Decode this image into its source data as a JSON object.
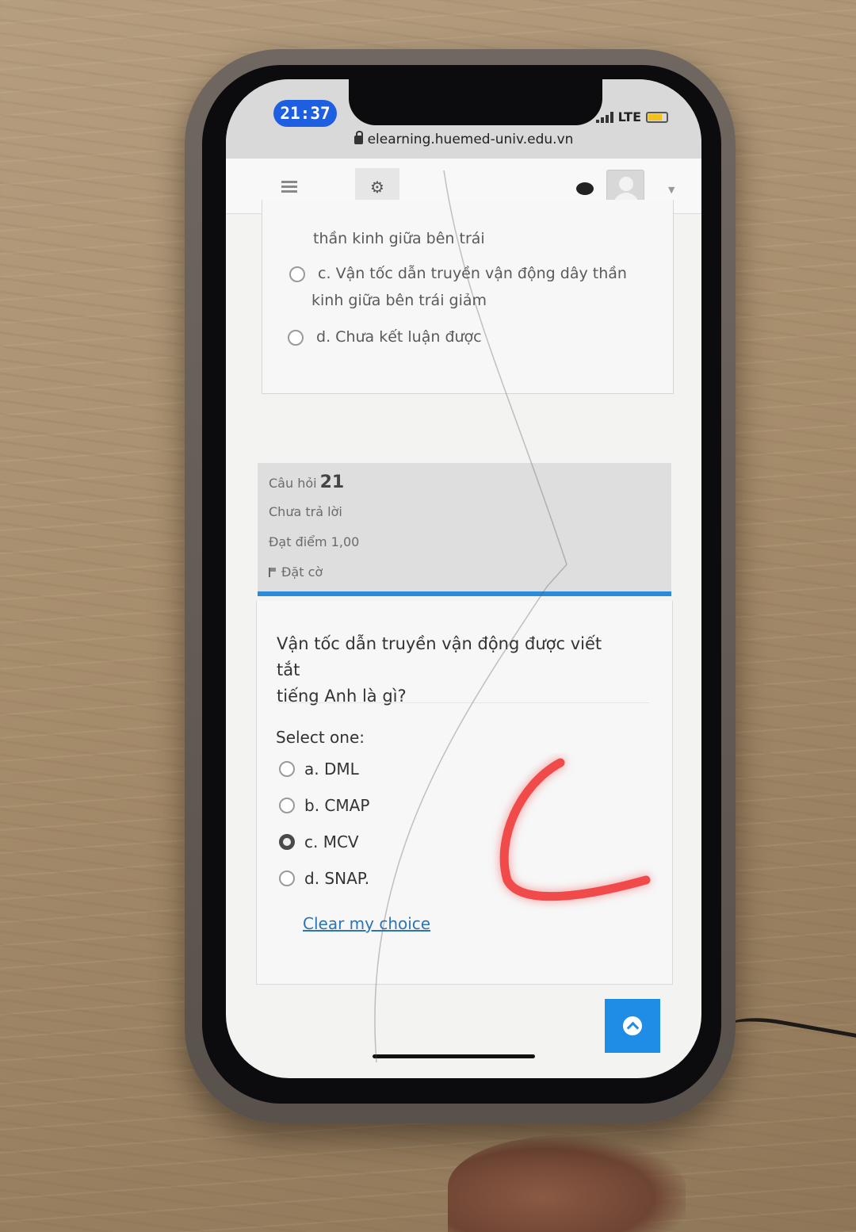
{
  "status": {
    "time": "21:37",
    "network": "LTE"
  },
  "browser": {
    "url": "elearning.huemed-univ.edu.vn"
  },
  "previous_question": {
    "options": [
      {
        "line1": "thần kinh giữa bên trái"
      },
      {
        "line1": "c. Vận tốc dẫn truyền vận động dây thần",
        "line2": "kinh giữa bên trái giảm"
      },
      {
        "line1": "d. Chưa kết luận được"
      }
    ]
  },
  "question": {
    "label": "Câu hỏi",
    "number": "21",
    "status": "Chưa trả lời",
    "points": "Đạt điểm 1,00",
    "flag": "Đặt cờ",
    "text_line1": "Vận tốc dẫn truyền vận động được viết tắt",
    "text_line2": "tiếng Anh là gì?",
    "select_label": "Select one:",
    "options": [
      {
        "label": "a. DML",
        "checked": false
      },
      {
        "label": "b. CMAP",
        "checked": false
      },
      {
        "label": "c. MCV",
        "checked": true
      },
      {
        "label": "d. SNAP.",
        "checked": false
      }
    ],
    "clear_choice": "Clear my choice"
  },
  "colors": {
    "accent": "#1f8ce6",
    "time_pill": "#1d5fe0",
    "link": "#2d74b5",
    "annotation": "#f04a4a"
  }
}
